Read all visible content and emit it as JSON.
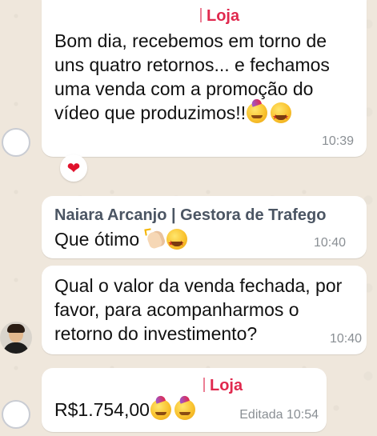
{
  "messages": [
    {
      "sender": "Loja",
      "lines": [
        "Bom dia, recebemos em torno de",
        "uns quatro retornos... e fechamos",
        "uma venda com a promoção do",
        "vídeo que produzimos!!"
      ],
      "emojis": [
        "partying-face",
        "star-struck"
      ],
      "time": "10:39",
      "reaction": "❤"
    },
    {
      "sender": "Naiara Arcanjo | Gestora de Trafego",
      "text": "Que ótimo",
      "emojis": [
        "clapping-hands",
        "star-struck"
      ],
      "time": "10:40"
    },
    {
      "lines": [
        "Qual o valor da venda fechada, por",
        "favor, para acompanharmos o",
        "retorno do investimento?"
      ],
      "time": "10:40"
    },
    {
      "sender": "Loja",
      "text": "R$1.754,00",
      "emojis": [
        "partying-face",
        "partying-face"
      ],
      "time": "Editada 10:54"
    }
  ],
  "colors": {
    "loja_sender": "#e0294e",
    "naiara_sender": "#4b5563",
    "background": "#efe7dc",
    "bubble": "#ffffff",
    "timestamp": "#8a8f94"
  }
}
